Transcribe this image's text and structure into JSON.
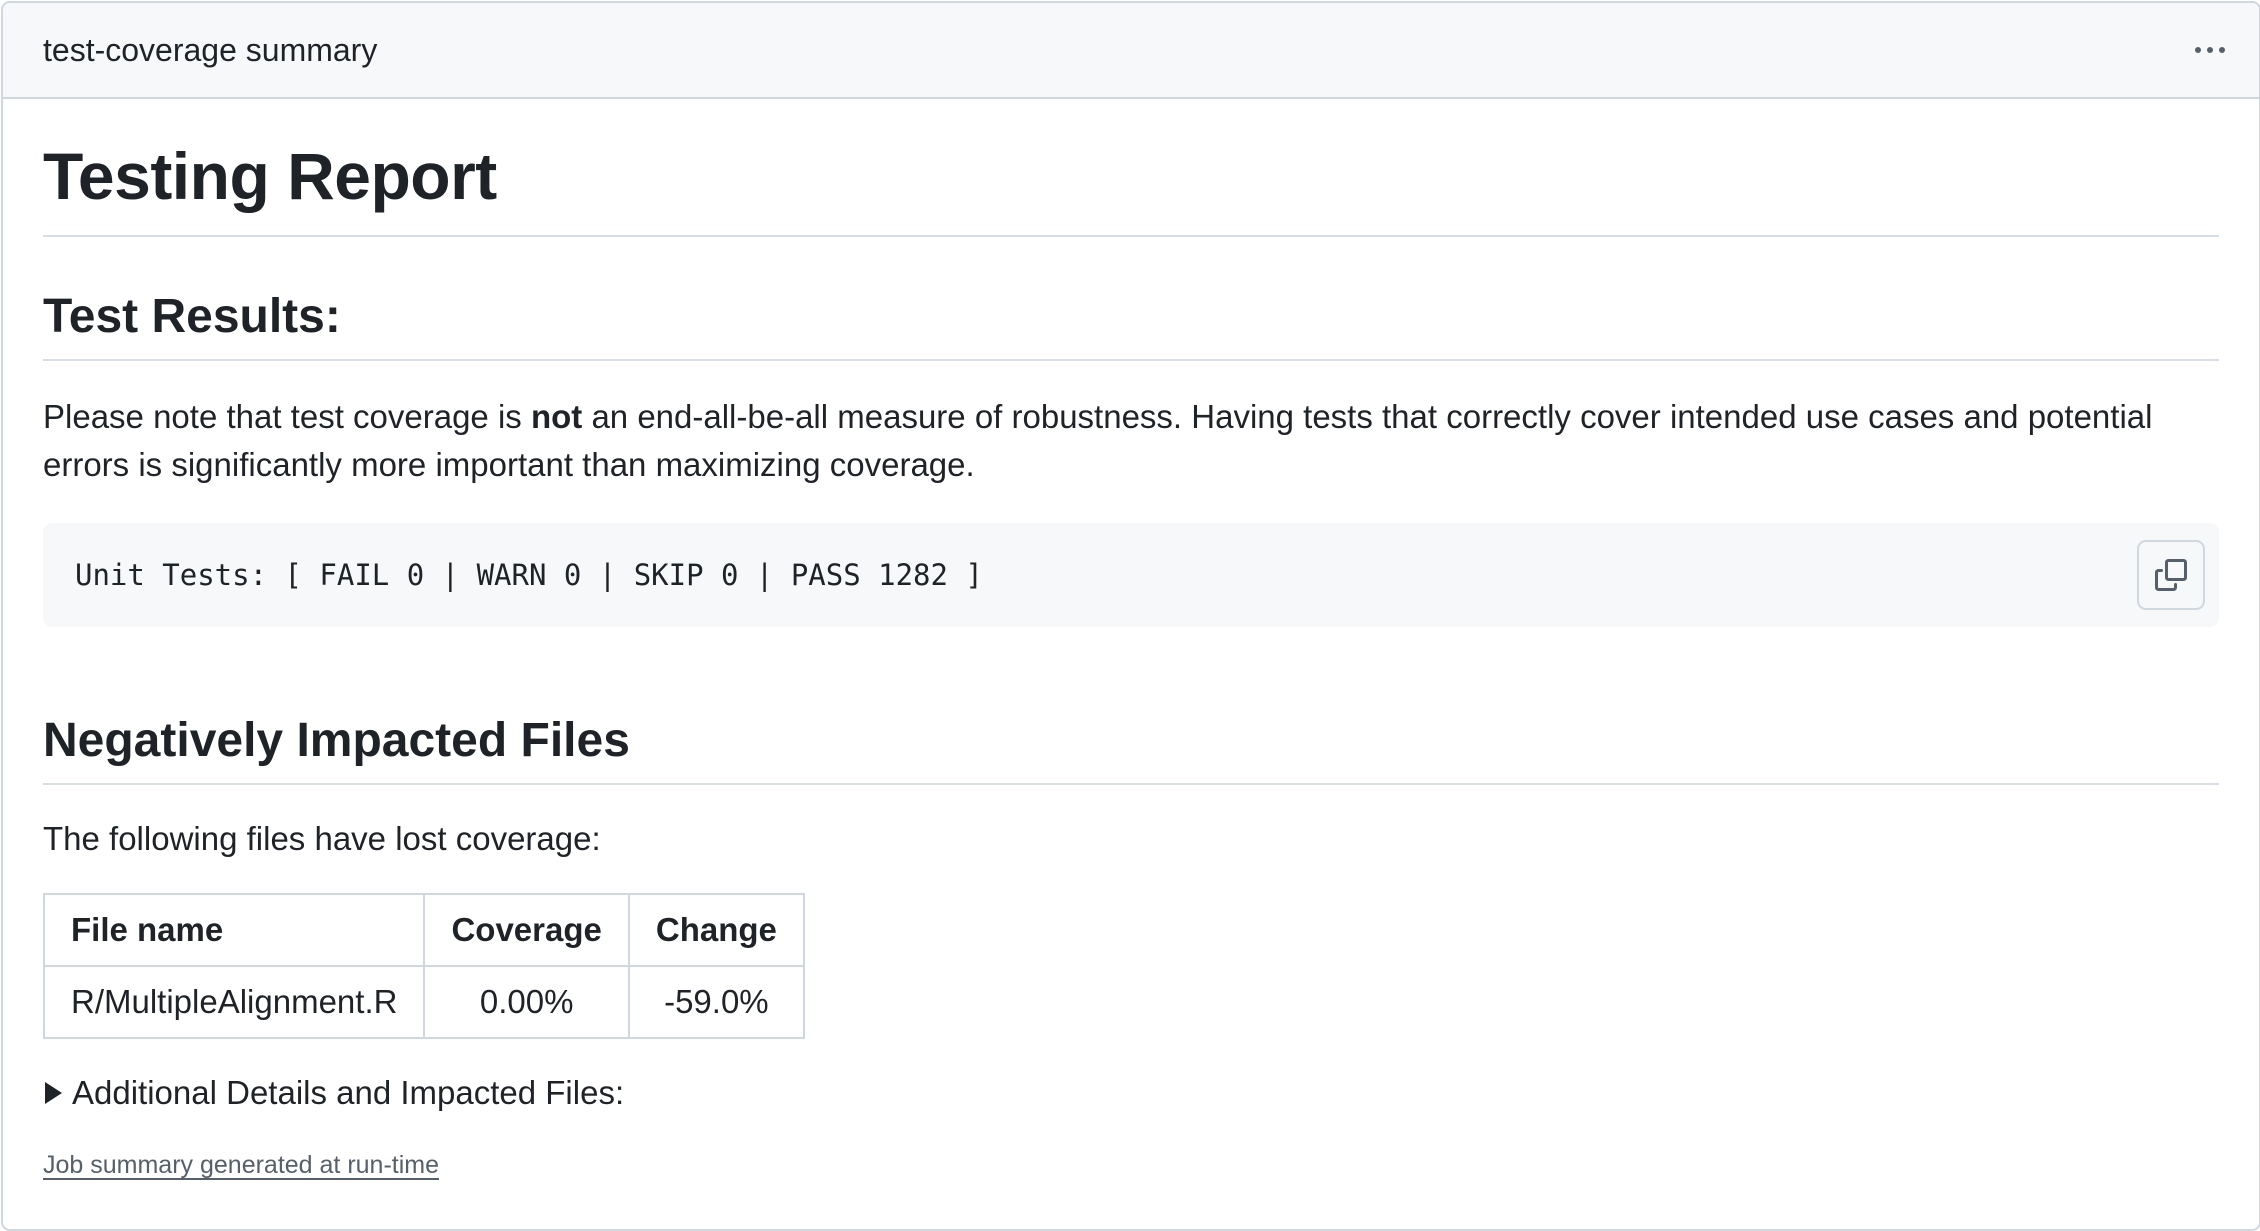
{
  "header": {
    "title": "test-coverage summary",
    "menu_icon": "kebab-horizontal-icon"
  },
  "report": {
    "title": "Testing Report",
    "results_heading": "Test Results:",
    "note_before": "Please note that test coverage is ",
    "note_bold": "not",
    "note_after": " an end-all-be-all measure of robustness. Having tests that correctly cover intended use cases and potential errors is significantly more important than maximizing coverage.",
    "unit_tests": "Unit Tests: [ FAIL 0 | WARN 0 | SKIP 0 | PASS 1282 ]",
    "copy_icon": "copy-icon"
  },
  "impacted": {
    "heading": "Negatively Impacted Files",
    "intro": "The following files have lost coverage:",
    "columns": [
      "File name",
      "Coverage",
      "Change"
    ],
    "rows": [
      [
        "R/MultipleAlignment.R",
        "0.00%",
        "-59.0%"
      ]
    ],
    "details_label": "Additional Details and Impacted Files:"
  },
  "footer": {
    "link": "Job summary generated at run-time"
  }
}
